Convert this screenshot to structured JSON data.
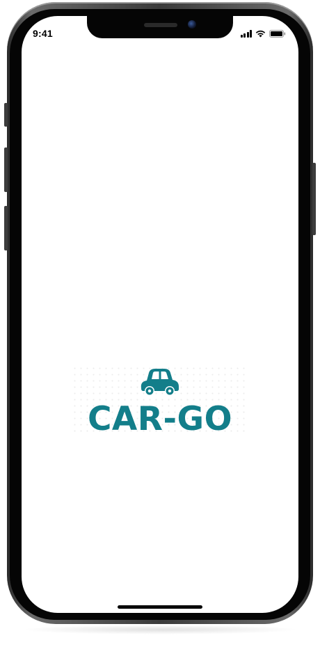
{
  "status_bar": {
    "time": "9:41",
    "icons": [
      "cellular-signal-icon",
      "wifi-icon",
      "battery-icon"
    ]
  },
  "splash": {
    "logo_icon": "car-icon",
    "logo_text": "CAR-GO",
    "brand_color": "#137e8a"
  },
  "device": {
    "frame_color": "#050505",
    "screen_color": "#ffffff"
  }
}
